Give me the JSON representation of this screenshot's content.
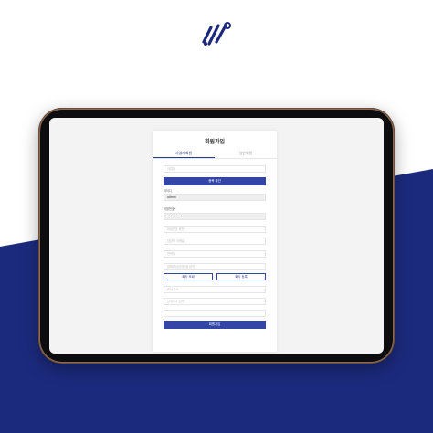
{
  "colors": {
    "navy": "#1c2a7e",
    "accent": "#3346a8"
  },
  "icons": {
    "logo": "stylized-nodes-logo-icon"
  },
  "form": {
    "title": "회원가입",
    "tabs": [
      {
        "label": "사업자회원",
        "active": true
      },
      {
        "label": "일반회원",
        "active": false
      }
    ],
    "fields": {
      "business_number_placeholder": "사업자",
      "verify_button": "중복 확인",
      "id_label": "아이디",
      "id_value": "admin",
      "password_label": "비밀번호*",
      "password_value": "••••••••",
      "password_confirm_placeholder": "비밀번호 확인",
      "email_placeholder": "담당자 이메일",
      "phone_placeholder": "연락처",
      "company_placeholder": "업체명(상호명)을 입력",
      "search_button": "회사 조회",
      "register_button": "회사 등록",
      "address_placeholder": "회사 주소",
      "address_detail_placeholder": "상세주소 입력",
      "extra_placeholder": "",
      "submit_button": "회원가입"
    }
  }
}
